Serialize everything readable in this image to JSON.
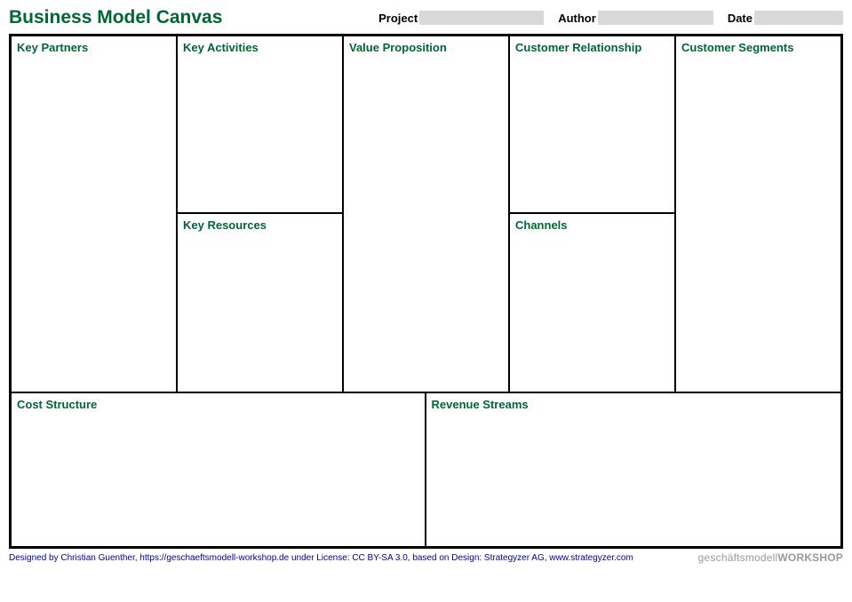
{
  "title": "Business Model Canvas",
  "meta": {
    "project_label": "Project",
    "author_label": "Author",
    "date_label": "Date",
    "project_value": "",
    "author_value": "",
    "date_value": ""
  },
  "sections": {
    "key_partners": "Key Partners",
    "key_activities": "Key Activities",
    "key_resources": "Key Resources",
    "value_proposition": "Value Proposition",
    "customer_relationship": "Customer Relationship",
    "channels": "Channels",
    "customer_segments": "Customer Segments",
    "cost_structure": "Cost Structure",
    "revenue_streams": "Revenue Streams"
  },
  "footer": {
    "attribution": "Designed by Christian Guenther, https://geschaeftsmodell-workshop.de under License: CC BY-SA 3.0, based on Design: Strategyzer AG, www.strategyzer.com",
    "brand_prefix": "geschäftsmodell",
    "brand_suffix": "WORKSHOP"
  }
}
